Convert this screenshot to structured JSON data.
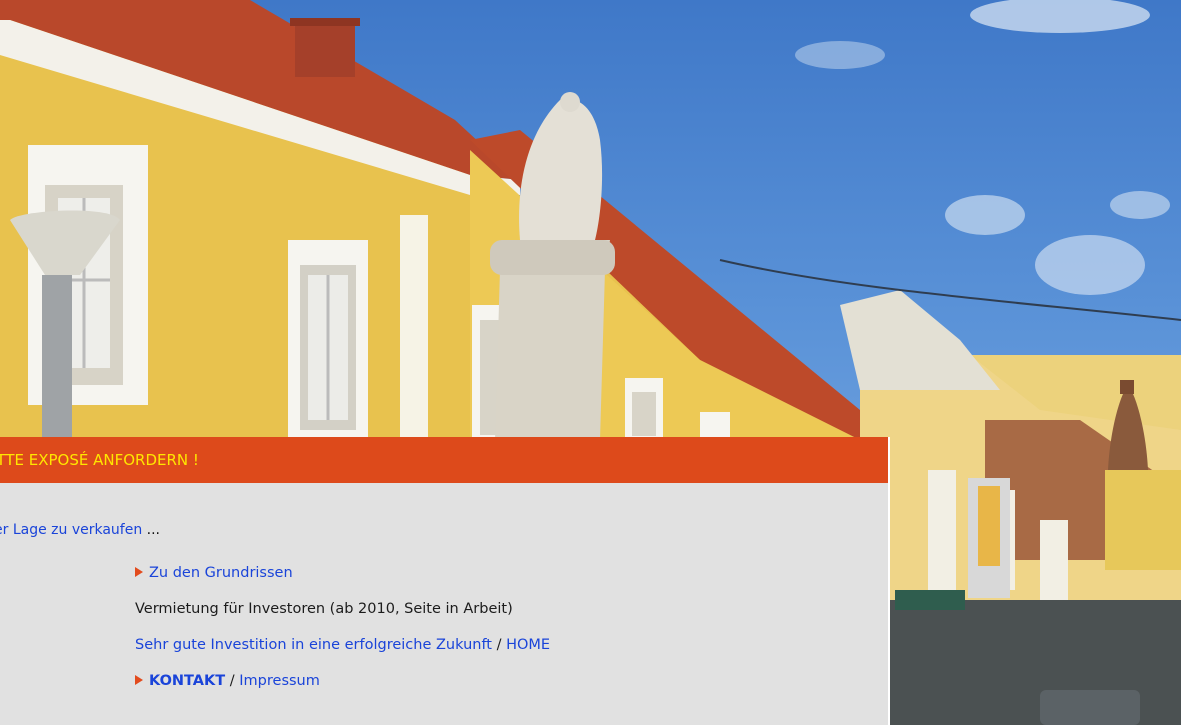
{
  "panel": {
    "header_title": "ITTE EXPOSÉ ANFORDERN !",
    "intro_link": "er Lage zu verkaufen",
    "intro_suffix": " ..."
  },
  "menu": {
    "grundrisse": "Zu den Grundrissen",
    "vermietung": "Vermietung für Investoren (ab 2010, Seite in Arbeit)",
    "investition_link": "Sehr gute Investition in eine erfolgreiche Zukunft",
    "separator": " / ",
    "home_link": "HOME",
    "kontakt_link": "KONTAKT",
    "impressum_link": "Impressum"
  },
  "colors": {
    "header_bg": "#dd4a1b",
    "header_text": "#ffe600",
    "link": "#1a44d9",
    "panel_bg": "#e1e1e1",
    "arrow": "#e24b1d"
  }
}
